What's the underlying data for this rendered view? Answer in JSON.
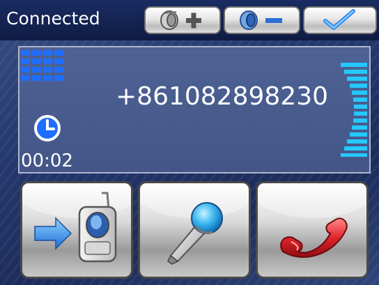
{
  "status_bar": {
    "connection_status": "Connected",
    "buttons": [
      {
        "name": "volume-up-button",
        "icon": "speaker-plus-icon"
      },
      {
        "name": "volume-down-button",
        "icon": "speaker-minus-icon"
      },
      {
        "name": "confirm-button",
        "icon": "checkmark-icon"
      }
    ]
  },
  "call_display": {
    "phone_number": "+861082898230",
    "call_duration": "00:02",
    "signal_icon": "signal-bars-icon",
    "timer_icon": "clock-icon",
    "volume_meter_icon": "volume-level-icon"
  },
  "actions": [
    {
      "name": "transfer-to-phone-button",
      "icon": "transfer-to-phone-icon"
    },
    {
      "name": "microphone-button",
      "icon": "microphone-icon"
    },
    {
      "name": "hang-up-button",
      "icon": "hang-up-icon"
    }
  ],
  "colors": {
    "accent_blue": "#1f7bff",
    "meter_cyan": "#25c8ff",
    "hangup_red": "#e0242c"
  }
}
